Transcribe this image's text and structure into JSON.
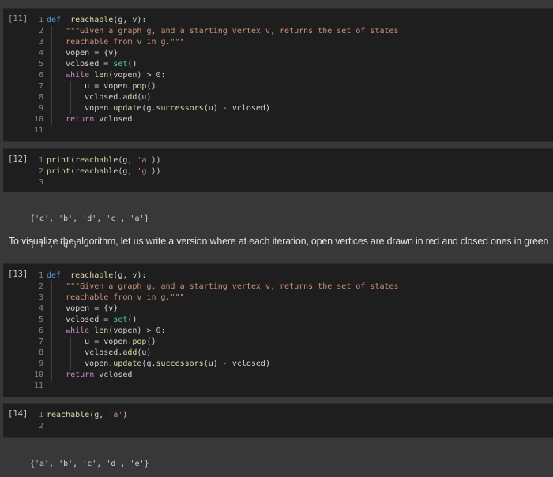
{
  "cells": [
    {
      "exec_count": "[11]",
      "lines": [
        {
          "n": "1",
          "tokens": [
            [
              "kw",
              "def"
            ],
            [
              "",
              "  "
            ],
            [
              "fn",
              "reachable"
            ],
            [
              "",
              "(g, v):"
            ]
          ]
        },
        {
          "n": "2",
          "tokens": [
            [
              "",
              "    "
            ],
            [
              "str",
              "\"\"\"Given a graph g, and a starting vertex v, returns the set of states"
            ]
          ]
        },
        {
          "n": "3",
          "tokens": [
            [
              "",
              "    "
            ],
            [
              "str",
              "reachable from v in g.\"\"\""
            ]
          ]
        },
        {
          "n": "4",
          "tokens": [
            [
              "",
              "    vopen = {v}"
            ]
          ]
        },
        {
          "n": "5",
          "tokens": [
            [
              "",
              "    vclosed = "
            ],
            [
              "bi",
              "set"
            ],
            [
              "",
              "()"
            ]
          ]
        },
        {
          "n": "6",
          "tokens": [
            [
              "",
              "    "
            ],
            [
              "kw2",
              "while"
            ],
            [
              "",
              ""
            ],
            [
              "fn",
              " len"
            ],
            [
              "",
              "(vopen) > "
            ],
            [
              "num",
              "0"
            ],
            [
              "",
              ":"
            ]
          ]
        },
        {
          "n": "7",
          "tokens": [
            [
              "",
              "        u = vopen."
            ],
            [
              "fn",
              "pop"
            ],
            [
              "",
              "()"
            ]
          ]
        },
        {
          "n": "8",
          "tokens": [
            [
              "",
              "        vclosed."
            ],
            [
              "fn",
              "add"
            ],
            [
              "",
              "(u)"
            ]
          ]
        },
        {
          "n": "9",
          "tokens": [
            [
              "",
              "        vopen."
            ],
            [
              "fn",
              "update"
            ],
            [
              "",
              "(g."
            ],
            [
              "fn",
              "successors"
            ],
            [
              "",
              "(u) - vclosed)"
            ]
          ]
        },
        {
          "n": "10",
          "tokens": [
            [
              "",
              "    "
            ],
            [
              "kw2",
              "return"
            ],
            [
              "",
              " vclosed"
            ]
          ]
        },
        {
          "n": "11",
          "tokens": []
        }
      ]
    },
    {
      "exec_count": "[12]",
      "lines": [
        {
          "n": "1",
          "tokens": [
            [
              "fn",
              "print"
            ],
            [
              "",
              "("
            ],
            [
              "fn",
              "reachable"
            ],
            [
              "",
              "(g, "
            ],
            [
              "str",
              "'a'"
            ],
            [
              "",
              "))"
            ]
          ]
        },
        {
          "n": "2",
          "tokens": [
            [
              "fn",
              "print"
            ],
            [
              "",
              "("
            ],
            [
              "fn",
              "reachable"
            ],
            [
              "",
              "(g, "
            ],
            [
              "str",
              "'g'"
            ],
            [
              "",
              "))"
            ]
          ]
        },
        {
          "n": "3",
          "tokens": []
        }
      ],
      "output": [
        "{'e', 'b', 'd', 'c', 'a'}",
        "{'f', 'g'}"
      ]
    },
    {
      "exec_count": "[13]",
      "lines": [
        {
          "n": "1",
          "tokens": [
            [
              "kw",
              "def"
            ],
            [
              "",
              "  "
            ],
            [
              "fn",
              "reachable"
            ],
            [
              "",
              "(g, v):"
            ]
          ]
        },
        {
          "n": "2",
          "tokens": [
            [
              "",
              "    "
            ],
            [
              "str",
              "\"\"\"Given a graph g, and a starting vertex v, returns the set of states"
            ]
          ]
        },
        {
          "n": "3",
          "tokens": [
            [
              "",
              "    "
            ],
            [
              "str",
              "reachable from v in g.\"\"\""
            ]
          ]
        },
        {
          "n": "4",
          "tokens": [
            [
              "",
              "    vopen = {v}"
            ]
          ]
        },
        {
          "n": "5",
          "tokens": [
            [
              "",
              "    vclosed = "
            ],
            [
              "bi",
              "set"
            ],
            [
              "",
              "()"
            ]
          ]
        },
        {
          "n": "6",
          "tokens": [
            [
              "",
              "    "
            ],
            [
              "kw2",
              "while"
            ],
            [
              "fn",
              " len"
            ],
            [
              "",
              "(vopen) > "
            ],
            [
              "num",
              "0"
            ],
            [
              "",
              ":"
            ]
          ]
        },
        {
          "n": "7",
          "tokens": [
            [
              "",
              "        u = vopen."
            ],
            [
              "fn",
              "pop"
            ],
            [
              "",
              "()"
            ]
          ]
        },
        {
          "n": "8",
          "tokens": [
            [
              "",
              "        vclosed."
            ],
            [
              "fn",
              "add"
            ],
            [
              "",
              "(u)"
            ]
          ]
        },
        {
          "n": "9",
          "tokens": [
            [
              "",
              "        vopen."
            ],
            [
              "fn",
              "update"
            ],
            [
              "",
              "(g."
            ],
            [
              "fn",
              "successors"
            ],
            [
              "",
              "(u) - vclosed)"
            ]
          ]
        },
        {
          "n": "10",
          "tokens": [
            [
              "",
              "    "
            ],
            [
              "kw2",
              "return"
            ],
            [
              "",
              " vclosed"
            ]
          ]
        },
        {
          "n": "11",
          "tokens": []
        }
      ]
    },
    {
      "exec_count": "[14]",
      "lines": [
        {
          "n": "1",
          "tokens": [
            [
              "fn",
              "reachable"
            ],
            [
              "",
              "(g, "
            ],
            [
              "str",
              "'a'"
            ],
            [
              "",
              ")"
            ]
          ]
        },
        {
          "n": "2",
          "tokens": []
        }
      ],
      "output": [
        "{'a', 'b', 'c', 'd', 'e'}"
      ]
    }
  ],
  "markdown_text": "To visualize the algorithm, let us write a version where at each iteration, open vertices are drawn in red and closed ones in green"
}
